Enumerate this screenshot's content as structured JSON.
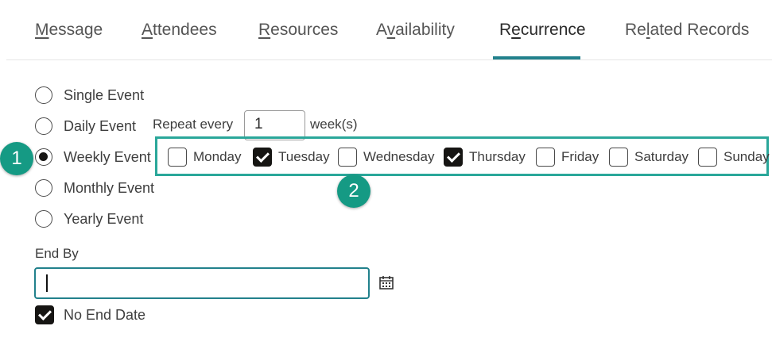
{
  "tabs": [
    {
      "pre": "",
      "ul": "M",
      "post": "essage"
    },
    {
      "pre": "",
      "ul": "A",
      "post": "ttendees"
    },
    {
      "pre": "",
      "ul": "R",
      "post": "esources"
    },
    {
      "pre": "A",
      "ul": "v",
      "post": "ailability"
    },
    {
      "pre": "R",
      "ul": "e",
      "post": "currence"
    },
    {
      "pre": "Re",
      "ul": "l",
      "post": "ated Records"
    }
  ],
  "active_tab": "Recurrence",
  "event_types": [
    "Single Event",
    "Daily Event",
    "Weekly Event",
    "Monthly Event",
    "Yearly Event"
  ],
  "selected_event_type": "Weekly Event",
  "repeat": {
    "label": "Repeat every",
    "value": "1",
    "unit": "week(s)"
  },
  "days": [
    {
      "label": "Monday",
      "checked": false
    },
    {
      "label": "Tuesday",
      "checked": true
    },
    {
      "label": "Wednesday",
      "checked": false
    },
    {
      "label": "Thursday",
      "checked": true
    },
    {
      "label": "Friday",
      "checked": false
    },
    {
      "label": "Saturday",
      "checked": false
    },
    {
      "label": "Sunday",
      "checked": false
    }
  ],
  "callouts": [
    "1",
    "2"
  ],
  "end_by": {
    "label": "End By",
    "value": ""
  },
  "no_end_date": {
    "label": "No End Date",
    "checked": true
  },
  "colors": {
    "accent": "#22818c",
    "callout": "#159a84",
    "highlight_border": "#2aa79a",
    "checked": "#161513"
  },
  "icons": {
    "calendar": "calendar-icon"
  }
}
